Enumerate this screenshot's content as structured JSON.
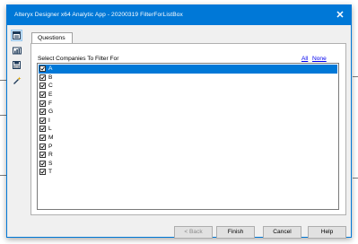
{
  "window": {
    "title": "Alteryx Designer x64 Analytic App - 20200319 FilterForListBox",
    "close_glyph": "✕"
  },
  "sidebar": {
    "icons": [
      "interface-icon",
      "chart-icon",
      "save-icon",
      "magic-wand-icon"
    ],
    "selected_index": 0
  },
  "tabs": [
    {
      "label": "Questions"
    }
  ],
  "question": {
    "label": "Select Companies To Filter For",
    "all_link": "All",
    "none_link": "None",
    "items": [
      {
        "label": "A",
        "checked": true,
        "selected": true
      },
      {
        "label": "B",
        "checked": true,
        "selected": false
      },
      {
        "label": "C",
        "checked": true,
        "selected": false
      },
      {
        "label": "E",
        "checked": true,
        "selected": false
      },
      {
        "label": "F",
        "checked": true,
        "selected": false
      },
      {
        "label": "G",
        "checked": true,
        "selected": false
      },
      {
        "label": "I",
        "checked": true,
        "selected": false
      },
      {
        "label": "L",
        "checked": true,
        "selected": false
      },
      {
        "label": "M",
        "checked": true,
        "selected": false
      },
      {
        "label": "P",
        "checked": true,
        "selected": false
      },
      {
        "label": "R",
        "checked": true,
        "selected": false
      },
      {
        "label": "S",
        "checked": true,
        "selected": false
      },
      {
        "label": "T",
        "checked": true,
        "selected": false
      }
    ]
  },
  "buttons": {
    "back": "< Back",
    "finish": "Finish",
    "cancel": "Cancel",
    "help": "Help"
  },
  "colors": {
    "titlebar": "#0078d7",
    "selection": "#0078d7"
  }
}
